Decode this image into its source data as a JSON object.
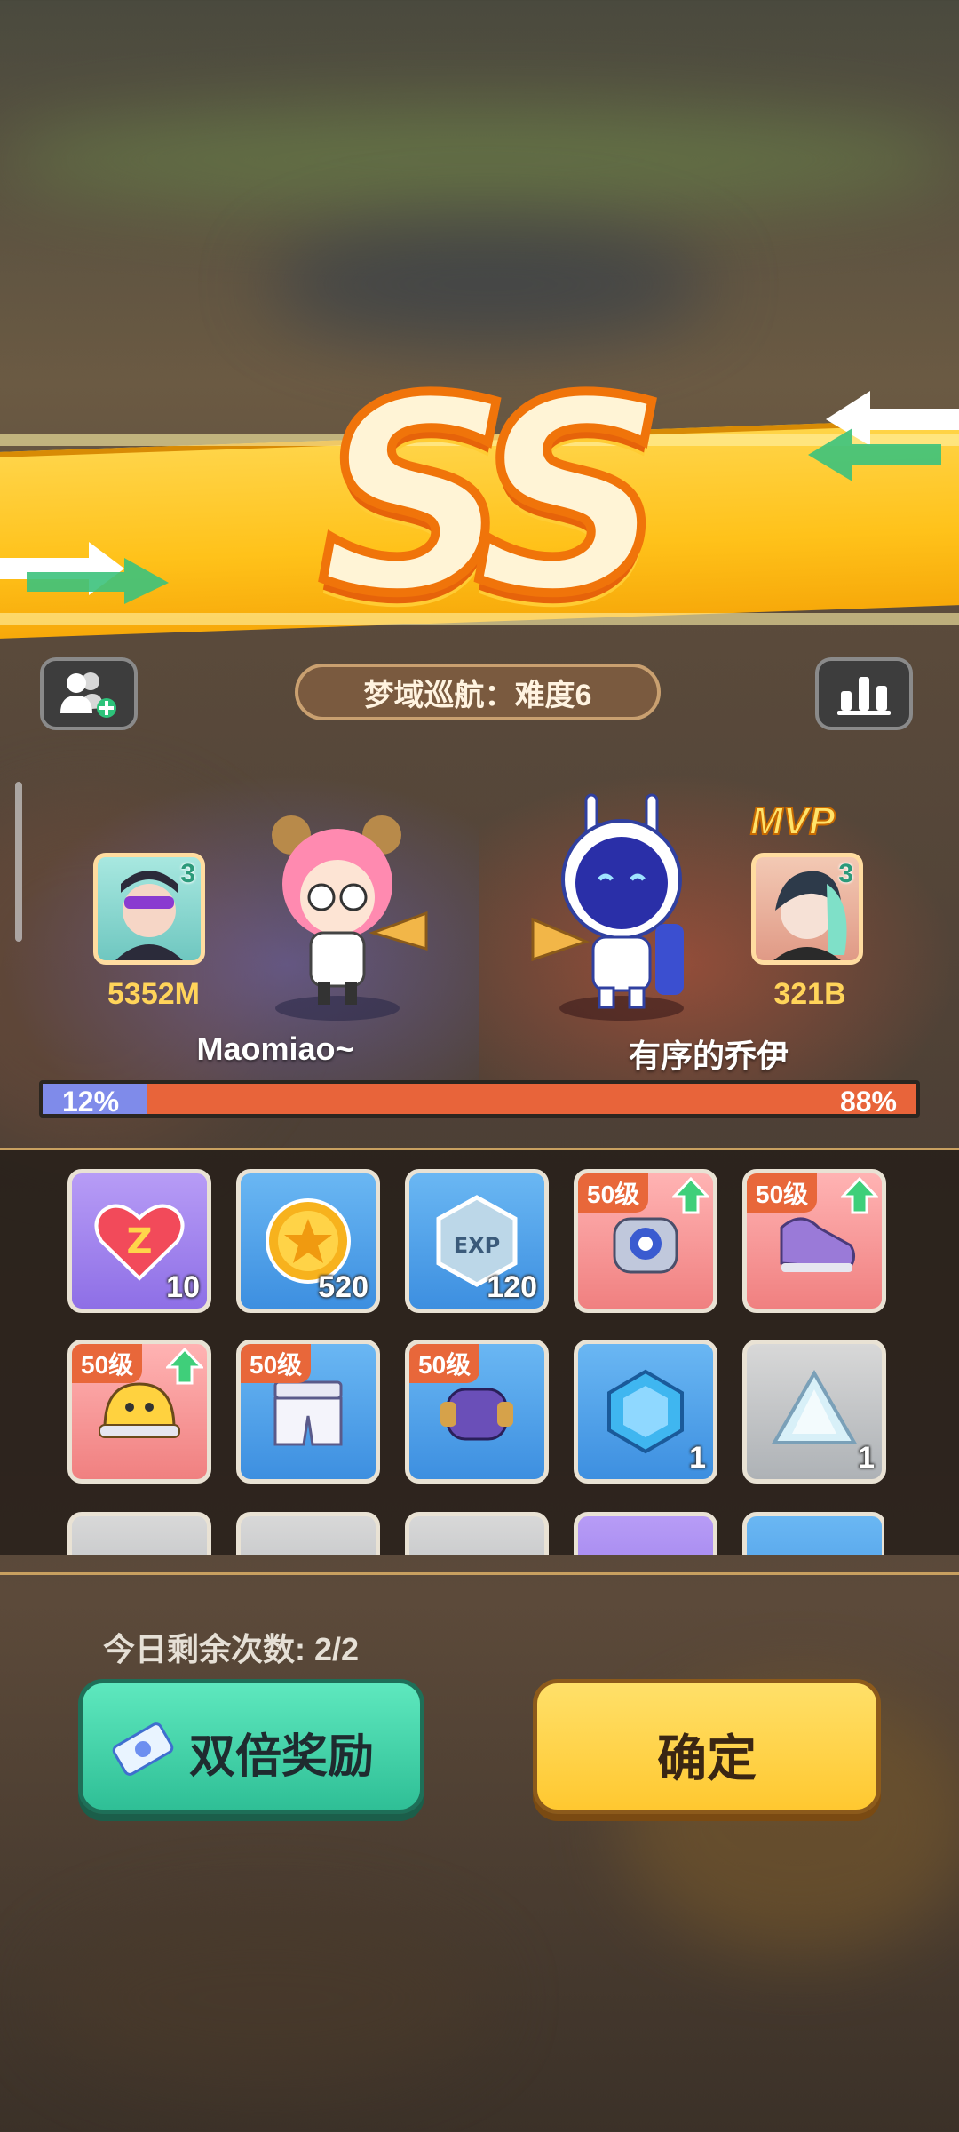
{
  "result": {
    "rank": "SS",
    "mode_title": "梦域巡航：难度6"
  },
  "players": [
    {
      "name": "Maomiao~",
      "score": "5352M",
      "level": "3",
      "percent": "12%"
    },
    {
      "name": "有序的乔伊",
      "score": "321B",
      "level": "3",
      "percent": "88%",
      "badge": "MVP"
    }
  ],
  "progress_ratio": 0.12,
  "rewards": [
    {
      "type": "heart-ticket-icon",
      "color": "purple",
      "count": "10"
    },
    {
      "type": "gold-coin-icon",
      "color": "blue",
      "count": "520"
    },
    {
      "type": "exp-badge-icon",
      "color": "blue",
      "count": "120"
    },
    {
      "type": "robot-eye-gear-icon",
      "color": "pink",
      "level": "50级",
      "upgrade": true
    },
    {
      "type": "purple-shoe-icon",
      "color": "pink",
      "level": "50级",
      "upgrade": true
    },
    {
      "type": "yellow-helmet-icon",
      "color": "pink",
      "level": "50级",
      "upgrade": true
    },
    {
      "type": "armor-pants-icon",
      "color": "blue",
      "level": "50级"
    },
    {
      "type": "purple-bracer-icon",
      "color": "blue",
      "level": "50级"
    },
    {
      "type": "blue-gem-icon",
      "color": "blue",
      "count": "1"
    },
    {
      "type": "white-crystal-icon",
      "color": "gray",
      "count": "1"
    }
  ],
  "remaining_label": "今日剩余次数: 2/2",
  "buttons": {
    "double_reward": "双倍奖励",
    "confirm": "确定"
  },
  "colors": {
    "banner": "#ffc21a",
    "rank_stroke": "#f0740a",
    "progress_left": "#7f8bea",
    "progress_right": "#e8643a",
    "double_button": "#2fbf96",
    "confirm_button": "#ffc830"
  }
}
